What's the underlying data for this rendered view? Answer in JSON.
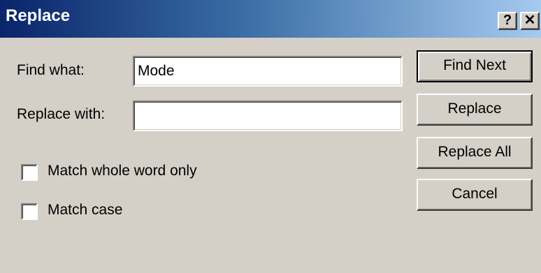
{
  "window": {
    "title": "Replace",
    "help_glyph": "?",
    "close_glyph": "✕"
  },
  "find": {
    "label": "Find what:",
    "value": "Mode"
  },
  "replace": {
    "label": "Replace with:",
    "value": ""
  },
  "options": {
    "whole_word_label": "Match whole word only",
    "whole_word_checked": false,
    "match_case_label": "Match case",
    "match_case_checked": false
  },
  "buttons": {
    "find_next": "Find Next",
    "replace": "Replace",
    "replace_all": "Replace All",
    "cancel": "Cancel"
  },
  "colors": {
    "dialog_face": "#d4d0c8",
    "title_start": "#0a246a",
    "title_end": "#a6caf0"
  }
}
